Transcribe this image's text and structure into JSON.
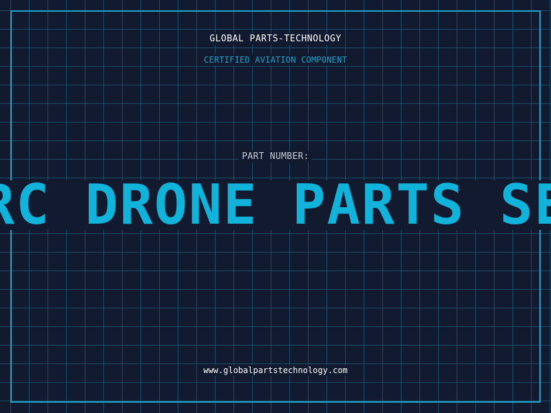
{
  "header": {
    "company": "GLOBAL PARTS-TECHNOLOGY",
    "subtitle": "CERTIFIED AVIATION COMPONENT"
  },
  "part": {
    "label": "PART NUMBER:",
    "value": "RC DRONE PARTS SET"
  },
  "footer": {
    "website": "www.globalpartstechnology.com"
  },
  "colors": {
    "background": "#111a2f",
    "grid": "#1e5f78",
    "frame": "#1aa6cf",
    "accent": "#12b3da"
  }
}
